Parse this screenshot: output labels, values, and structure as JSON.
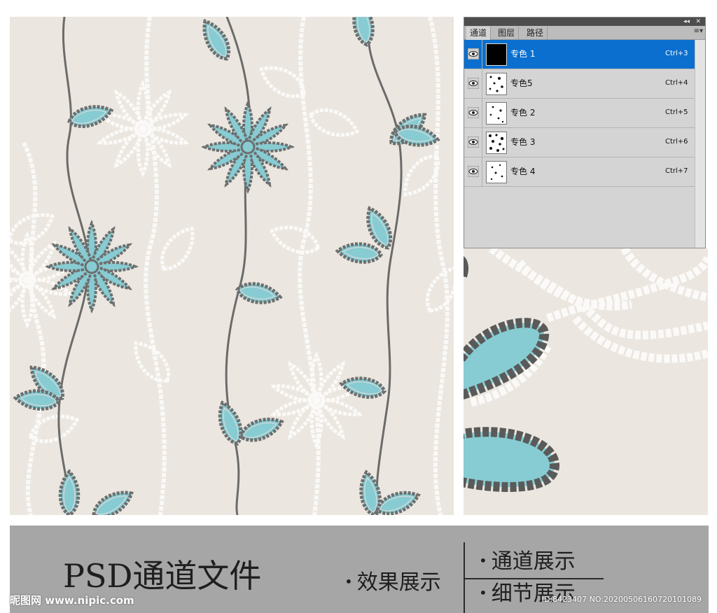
{
  "colors": {
    "background": "#ebe7e0",
    "accent_teal": "#87ccd2",
    "stem_gray": "#6b6b6b",
    "white_motif": "#fbfaf8",
    "selection_blue": "#0a6fcf",
    "banner_gray": "#a6a6a6"
  },
  "channels_panel": {
    "tabs": [
      {
        "label": "通道",
        "active": true
      },
      {
        "label": "图层",
        "active": false
      },
      {
        "label": "路径",
        "active": false
      }
    ],
    "title_controls": {
      "collapse": "◂◂",
      "close": "✕"
    },
    "menu_icon": "≡▾",
    "channels": [
      {
        "name": "专色 1",
        "shortcut": "Ctrl+3",
        "selected": true,
        "visible": true
      },
      {
        "name": "专色5",
        "shortcut": "Ctrl+4",
        "selected": false,
        "visible": true
      },
      {
        "name": "专色 2",
        "shortcut": "Ctrl+5",
        "selected": false,
        "visible": true
      },
      {
        "name": "专色 3",
        "shortcut": "Ctrl+6",
        "selected": false,
        "visible": true
      },
      {
        "name": "专色 4",
        "shortcut": "Ctrl+7",
        "selected": false,
        "visible": true
      }
    ]
  },
  "banner": {
    "title": "PSD通道文件",
    "items": [
      "效果展示",
      "通道展示",
      "细节展示"
    ],
    "watermark_left": "昵图网 www.nipic.com",
    "watermark_right": "ID:8423407 NO:20200506160720101089"
  }
}
